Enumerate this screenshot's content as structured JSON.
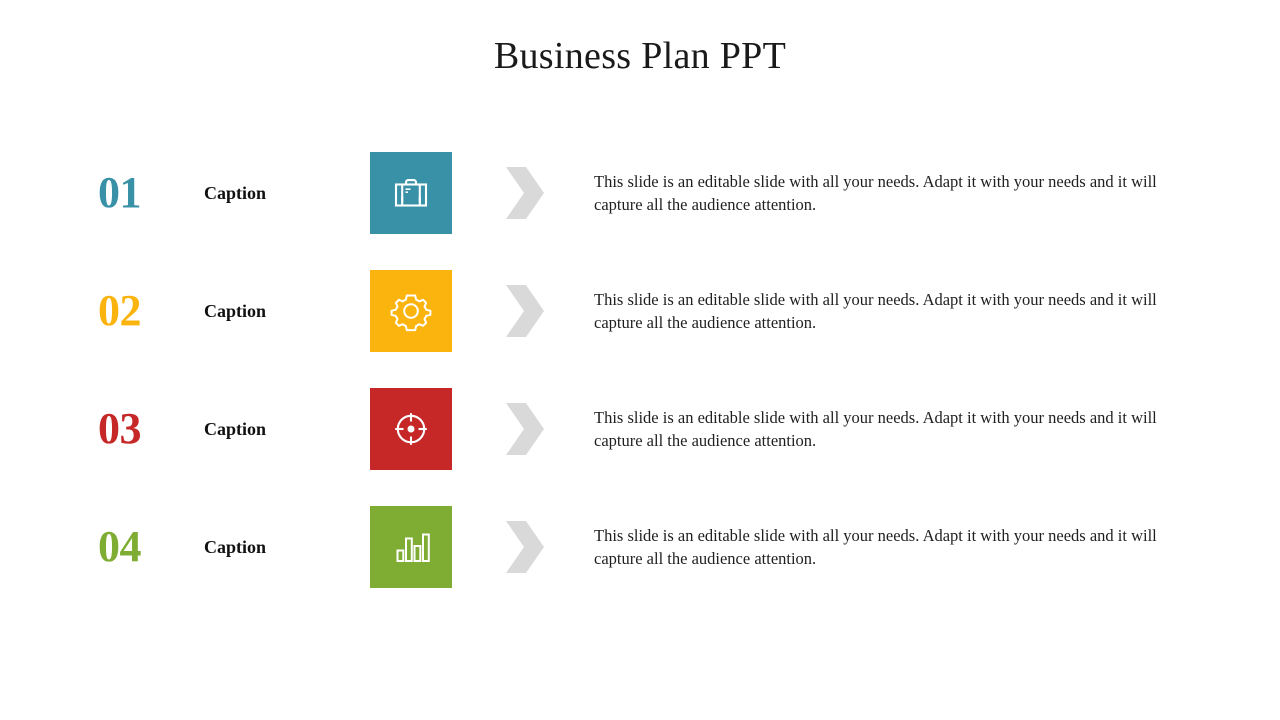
{
  "slide": {
    "title": "Business Plan PPT",
    "background_color": "#FFFFFF",
    "chevron_color": "#D9D9D9",
    "text_color": "#1F1F1F"
  },
  "rows": [
    {
      "number": "01",
      "caption": "Caption",
      "color": "#3891A6",
      "icon": "briefcase-icon",
      "body": "This slide is an editable slide with all your needs. Adapt it with your needs and it will capture all the audience attention."
    },
    {
      "number": "02",
      "caption": "Caption",
      "color": "#FBB40E",
      "icon": "gear-icon",
      "body": "This slide is an editable slide with all your needs. Adapt it with your needs and it will capture all the audience attention."
    },
    {
      "number": "03",
      "caption": "Caption",
      "color": "#C62828",
      "icon": "target-icon",
      "body": "This slide is an editable slide with all your needs. Adapt it with your needs and it will capture all the audience attention."
    },
    {
      "number": "04",
      "caption": "Caption",
      "color": "#7FAD34",
      "icon": "bar-chart-icon",
      "body": "This slide is an editable slide with all your needs. Adapt it with your needs and it will capture all the audience attention."
    }
  ]
}
